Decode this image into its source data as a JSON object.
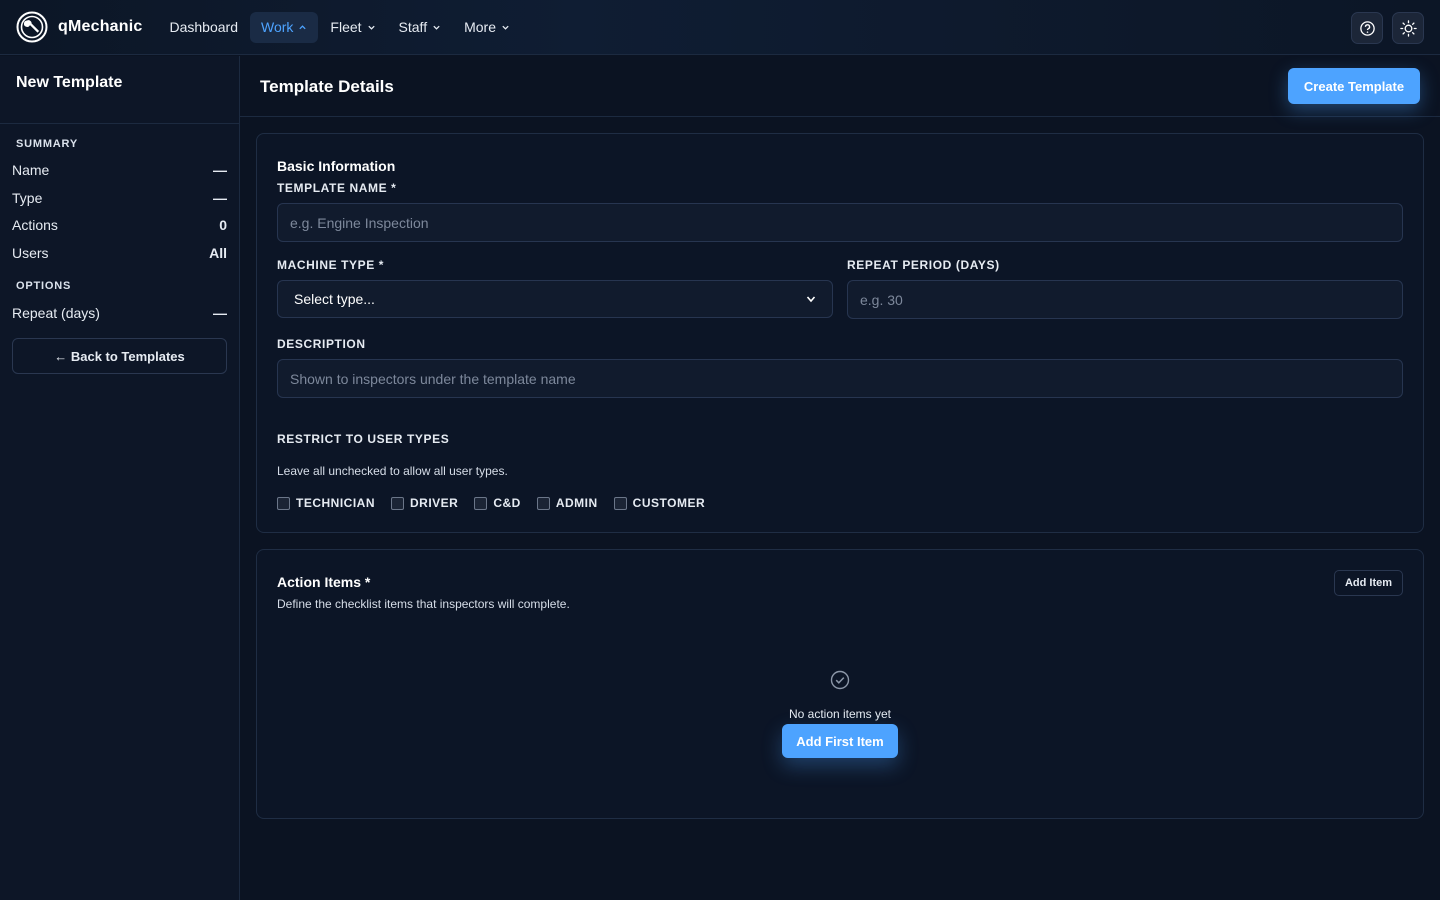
{
  "brand": {
    "name": "qMechanic",
    "logo_icon": "wrench-logo-icon"
  },
  "nav": [
    {
      "label": "Dashboard",
      "active": false,
      "dropdown": false
    },
    {
      "label": "Work",
      "active": true,
      "dropdown": true
    },
    {
      "label": "Fleet",
      "active": false,
      "dropdown": true
    },
    {
      "label": "Staff",
      "active": false,
      "dropdown": true
    },
    {
      "label": "More",
      "active": false,
      "dropdown": true
    }
  ],
  "topbar": {
    "help_icon": "help-icon",
    "theme_icon": "sun-icon"
  },
  "sidebar": {
    "title": "New Template",
    "summary_label": "SUMMARY",
    "summary": [
      {
        "label": "Name",
        "value": "—"
      },
      {
        "label": "Type",
        "value": "—"
      },
      {
        "label": "Actions",
        "value": "0"
      },
      {
        "label": "Users",
        "value": "All"
      }
    ],
    "options_label": "OPTIONS",
    "options": [
      {
        "label": "Repeat (days)",
        "value": "—"
      }
    ],
    "back_button": "← Back to Templates"
  },
  "header": {
    "title": "Template Details",
    "create_button": "Create Template"
  },
  "basic": {
    "title": "Basic Information",
    "template_name_label": "TEMPLATE NAME *",
    "template_name_placeholder": "e.g. Engine Inspection",
    "machine_type_label": "MACHINE TYPE *",
    "machine_type_value": "Select type...",
    "repeat_label": "REPEAT PERIOD (DAYS)",
    "repeat_placeholder": "e.g. 30",
    "description_label": "DESCRIPTION",
    "description_placeholder": "Shown to inspectors under the template name",
    "restrict_label": "RESTRICT TO USER TYPES",
    "restrict_hint": "Leave all unchecked to allow all user types.",
    "user_types": [
      "TECHNICIAN",
      "DRIVER",
      "C&D",
      "ADMIN",
      "CUSTOMER"
    ]
  },
  "actions": {
    "title": "Action Items *",
    "subtitle": "Define the checklist items that inspectors will complete.",
    "add_button": "Add Item",
    "empty_text": "No action items yet",
    "add_first_button": "Add First Item"
  },
  "colors": {
    "accent": "#4da3ff",
    "background": "#0b1322",
    "panel": "#0d1627"
  }
}
